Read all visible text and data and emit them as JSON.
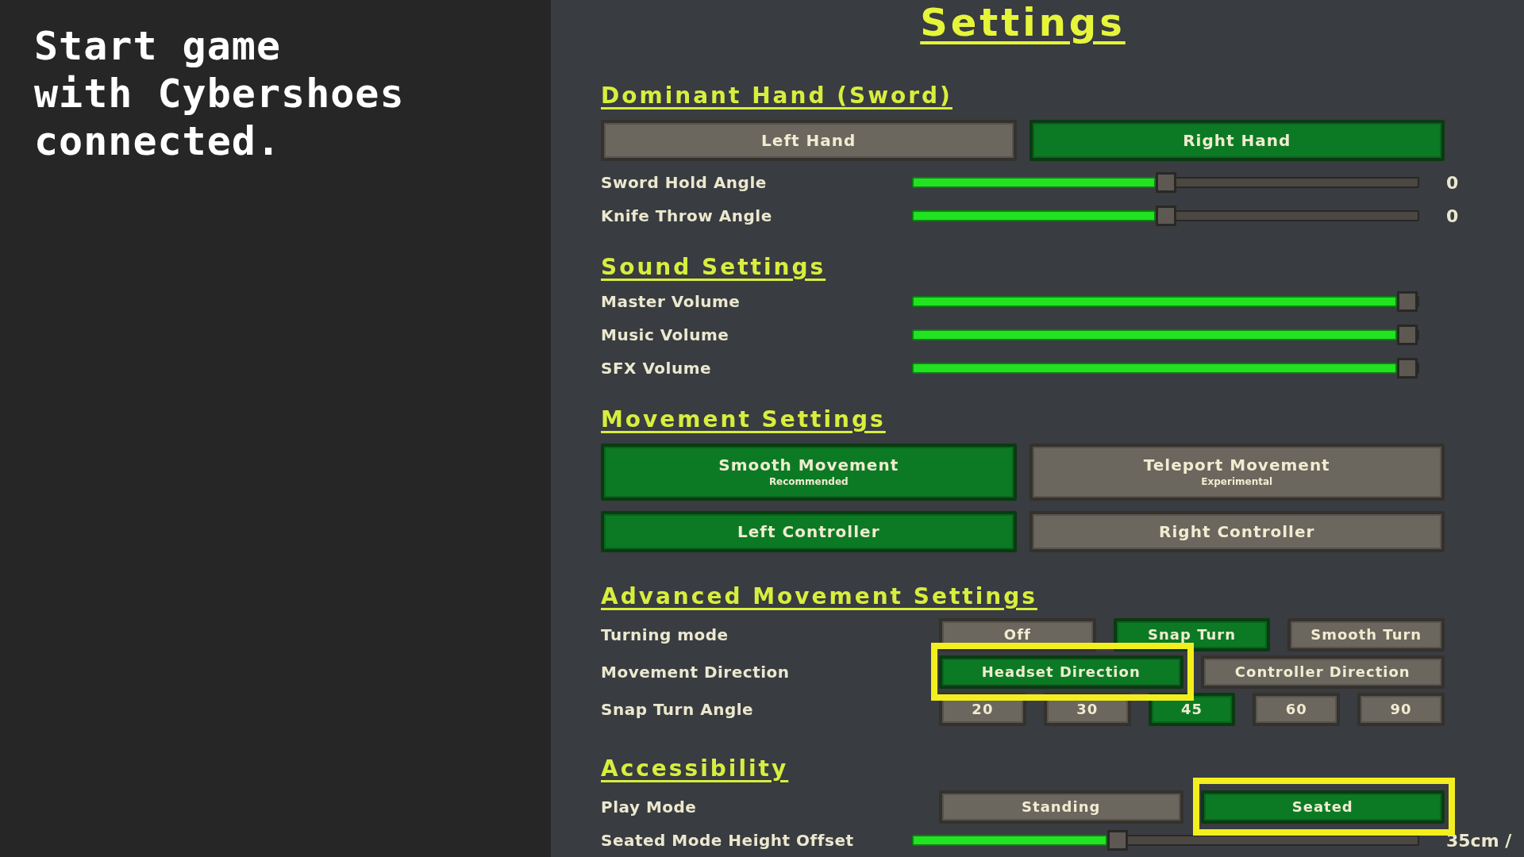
{
  "caption": {
    "text": "Start game\nwith Cybershoes\nconnected."
  },
  "settings": {
    "title": "Settings",
    "sections": [
      {
        "heading": "Dominant Hand (Sword)",
        "rows": [
          {
            "kind": "buttons",
            "options": [
              {
                "label": "Left Hand",
                "selected": false
              },
              {
                "label": "Right Hand",
                "selected": true
              }
            ]
          },
          {
            "kind": "slider",
            "label": "Sword Hold Angle",
            "level": 0.5,
            "reading": "0"
          },
          {
            "kind": "slider",
            "label": "Knife Throw Angle",
            "level": 0.5,
            "reading": "0"
          }
        ]
      },
      {
        "heading": "Sound Settings",
        "rows": [
          {
            "kind": "slider",
            "label": "Master Volume",
            "level": 1
          },
          {
            "kind": "slider",
            "label": "Music Volume",
            "level": 1
          },
          {
            "kind": "slider",
            "label": "SFX Volume",
            "level": 1
          }
        ]
      },
      {
        "heading": "Movement Settings",
        "rows": [
          {
            "kind": "buttons",
            "options": [
              {
                "label": "Smooth Movement",
                "note": "Recommended",
                "selected": true
              },
              {
                "label": "Teleport Movement",
                "note": "Experimental",
                "selected": false
              }
            ]
          },
          {
            "kind": "buttons",
            "options": [
              {
                "label": "Left Controller",
                "selected": true
              },
              {
                "label": "Right Controller",
                "selected": false
              }
            ]
          }
        ]
      },
      {
        "heading": "Advanced Movement Settings",
        "rows": [
          {
            "kind": "choice",
            "label": "Turning mode",
            "options": [
              {
                "label": "Off",
                "selected": false
              },
              {
                "label": "Snap Turn",
                "selected": true
              },
              {
                "label": "Smooth Turn",
                "selected": false
              }
            ]
          },
          {
            "kind": "choice",
            "label": "Movement Direction",
            "options": [
              {
                "label": "Headset Direction",
                "selected": true,
                "highlighted": true
              },
              {
                "label": "Controller Direction",
                "selected": false,
                "highlighted": false
              }
            ]
          },
          {
            "kind": "choice",
            "label": "Snap Turn Angle",
            "options": [
              {
                "label": "20",
                "selected": false
              },
              {
                "label": "30",
                "selected": false
              },
              {
                "label": "45",
                "selected": true
              },
              {
                "label": "60",
                "selected": false
              },
              {
                "label": "90",
                "selected": false
              }
            ]
          }
        ]
      },
      {
        "heading": "Accessibility",
        "rows": [
          {
            "kind": "choice",
            "label": "Play Mode",
            "options": [
              {
                "label": "Standing",
                "selected": false,
                "highlighted": false
              },
              {
                "label": "Seated",
                "selected": true,
                "highlighted": true
              }
            ]
          },
          {
            "kind": "slider",
            "label": "Seated Mode Height Offset",
            "level": 0.4,
            "reading": "35cm /"
          }
        ]
      }
    ]
  }
}
